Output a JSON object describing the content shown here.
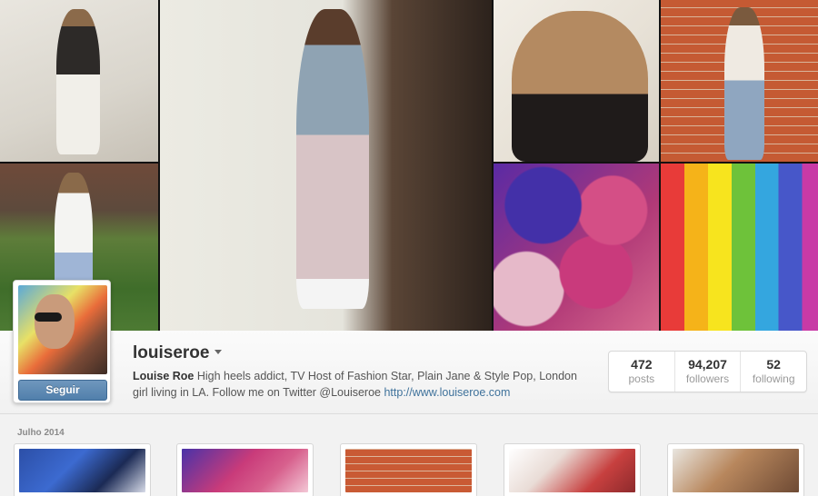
{
  "profile": {
    "username": "louiseroe",
    "follow_label": "Seguir",
    "bio_name": "Louise Roe",
    "bio_text": " High heels addict, TV Host of Fashion Star, Plain Jane & Style Pop, London girl living in LA. Follow me on Twitter @Louiseroe ",
    "bio_link": "http://www.louiseroe.com"
  },
  "stats": [
    {
      "value": "472",
      "label": "posts"
    },
    {
      "value": "94,207",
      "label": "followers"
    },
    {
      "value": "52",
      "label": "following"
    }
  ],
  "feed": {
    "month_label": "Julho 2014"
  },
  "colors": {
    "follow_button": "#517fab",
    "link": "#3f729b"
  }
}
